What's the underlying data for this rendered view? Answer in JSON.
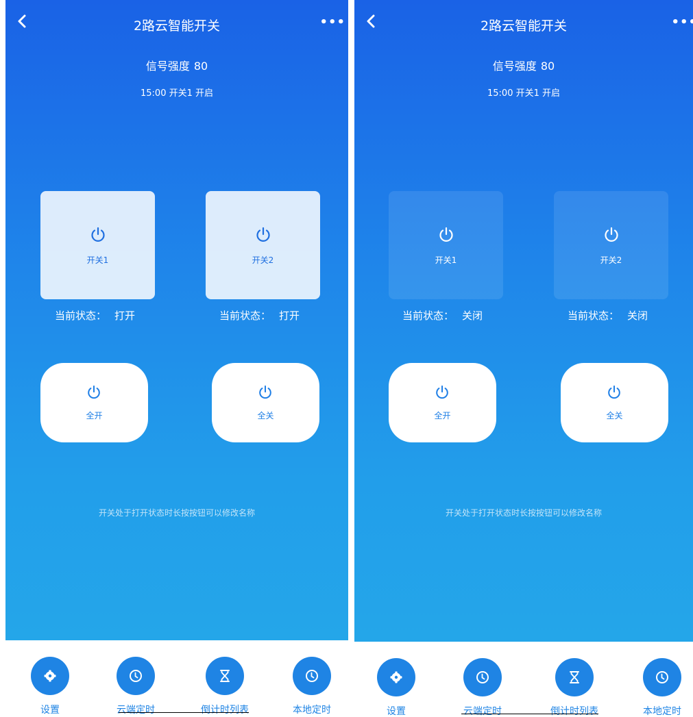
{
  "colors": {
    "gradient_top": "#1a62e6",
    "gradient_bottom": "#24a6e9",
    "accent": "#1f84e4",
    "tile_on": "#dce9f8",
    "white": "#ffffff"
  },
  "screens": [
    {
      "title": "2路云智能开关",
      "signal_label": "信号强度",
      "signal_value": "80",
      "timer_text": "15:00 开关1 开启",
      "switches": [
        {
          "label": "开关1",
          "state_label": "当前状态：",
          "state_value": "打开",
          "on": true
        },
        {
          "label": "开关2",
          "state_label": "当前状态：",
          "state_value": "打开",
          "on": true
        }
      ],
      "all_on_label": "全开",
      "all_off_label": "全关",
      "hint": "开关处于打开状态时长按按钮可以修改名称",
      "tabs": [
        {
          "label": "设置",
          "icon": "gear-icon"
        },
        {
          "label": "云端定时",
          "icon": "clock-icon"
        },
        {
          "label": "倒计时列表",
          "icon": "hourglass-icon"
        },
        {
          "label": "本地定时",
          "icon": "clock-icon"
        }
      ]
    },
    {
      "title": "2路云智能开关",
      "signal_label": "信号强度",
      "signal_value": "80",
      "timer_text": "15:00 开关1 开启",
      "switches": [
        {
          "label": "开关1",
          "state_label": "当前状态：",
          "state_value": "关闭",
          "on": false
        },
        {
          "label": "开关2",
          "state_label": "当前状态：",
          "state_value": "关闭",
          "on": false
        }
      ],
      "all_on_label": "全开",
      "all_off_label": "全关",
      "hint": "开关处于打开状态时长按按钮可以修改名称",
      "tabs": [
        {
          "label": "设置",
          "icon": "gear-icon"
        },
        {
          "label": "云端定时",
          "icon": "clock-icon"
        },
        {
          "label": "倒计时列表",
          "icon": "hourglass-icon"
        },
        {
          "label": "本地定时",
          "icon": "clock-icon"
        }
      ]
    }
  ]
}
